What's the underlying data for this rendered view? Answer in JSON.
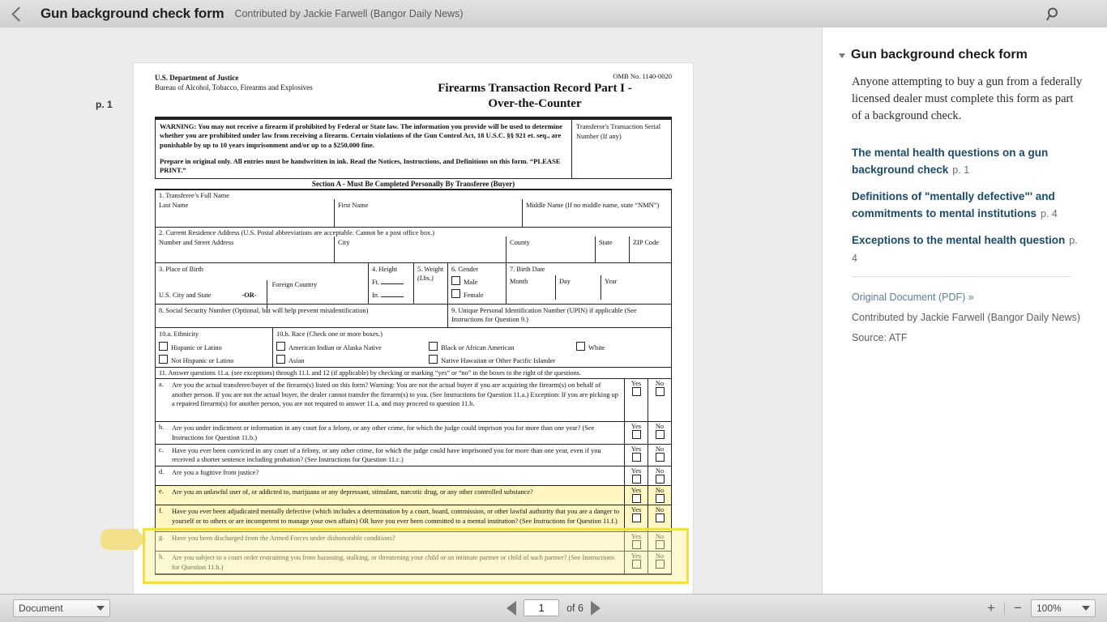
{
  "header": {
    "back_icon": "chevron-left-icon",
    "title": "Gun background check form",
    "credit": "Contributed by Jackie Farwell (Bangor Daily News)",
    "search_icon": "search-icon",
    "menu_icon": "hamburger-menu-icon"
  },
  "viewer": {
    "page_label": "p. 1"
  },
  "form": {
    "omb": "OMB No. 1140-0020",
    "agency_line1": "U.S. Department of Justice",
    "agency_line2": "Bureau of Alcohol, Tobacco, Firearms and Explosives",
    "title_line1": "Firearms Transaction Record Part I -",
    "title_line2": "Over-the-Counter",
    "warning_p1": "WARNING:  You may not receive a firearm if prohibited by Federal or State law.  The information you provide will be used to determine whether you are prohibited under law from receiving a firearm.  Certain violations of the Gun Control Act, 18 U.S.C. §§ 921 et. seq., are punishable by up to 10 years imprisonment and/or up to a $250,000 fine.",
    "warning_p2": "Prepare in original only.  All entries must be handwritten in ink.  Read the Notices, Instructions, and Definitions on this form. “PLEASE PRINT.”",
    "transferor_label": "Transferor's Transaction Serial Number (If any)",
    "section_a": "Section A - Must Be Completed Personally By Transferee (Buyer)",
    "q1_head": "1.   Transferee’s Full Name",
    "q1_last": "Last Name",
    "q1_first": "First Name",
    "q1_middle": "Middle Name (If no middle name, state “NMN”)",
    "q2_head": "2.   Current Residence Address  (U.S. Postal abbreviations are acceptable.  Cannot be a post office box.)",
    "q2_street": "Number and Street Address",
    "q2_city": "City",
    "q2_county": "County",
    "q2_state": "State",
    "q2_zip": "ZIP Code",
    "q3_head": "3.   Place of Birth",
    "q3_us": "U.S. City and State",
    "q3_or": "-OR-",
    "q3_foreign": "Foreign Country",
    "q4_head": "4.  Height",
    "q4_ft": "Ft.",
    "q4_in": "In.",
    "q5_head": "5.  Weight",
    "q5_lbs": "(Lbs.)",
    "q6_head": "6.  Gender",
    "q6_male": "Male",
    "q6_female": "Female",
    "q7_head": "7.  Birth Date",
    "q7_month": "Month",
    "q7_day": "Day",
    "q7_year": "Year",
    "q8": "8.   Social Security Number (Optional, but will help prevent misidentification)",
    "q9": "9.   Unique Personal Identification Number (UPIN) if applicable (See Instructions for Question 9.)",
    "q10a_head": "10.a.  Ethnicity",
    "q10a_opt1": "Hispanic or Latino",
    "q10a_opt2": "Not Hispanic or Latino",
    "q10b_head": "10.b.  Race (Check one or more boxes.)",
    "q10b_opt1": "American Indian or Alaska Native",
    "q10b_opt2": "Black or African American",
    "q10b_opt3": "White",
    "q10b_opt4": "Asian",
    "q10b_opt5": "Native Hawaiian or Other Pacific Islander",
    "q11_intro": "11.   Answer questions 11.a. (see exceptions) through 11.l. and 12 (if applicable) by checking or marking “yes” or “no” in the boxes to the right of the questions.",
    "yes": "Yes",
    "no": "No",
    "questions": [
      {
        "letter": "a.",
        "text": "Are you the actual transferee/buyer of the firearm(s) listed on this form?  Warning:  You are not the actual buyer if you are acquiring the firearm(s) on behalf of another person.  If you are not the actual buyer, the dealer cannot transfer the firearm(s) to you.  (See Instructions for Question 11.a.) Exception:  If you are picking up a repaired firearm(s) for another person, you are not required to answer 11.a. and may proceed to question 11.b.",
        "highlighted": false
      },
      {
        "letter": "b.",
        "text": "Are you under indictment or information in any court for a felony, or any other crime, for which the judge could imprison you for more than one year?  (See Instructions for Question 11.b.)",
        "highlighted": false
      },
      {
        "letter": "c.",
        "text": "Have you ever been convicted in any court of a felony, or any other crime, for which the judge could have imprisoned you for more than one year, even if you received a shorter sentence including probation?  (See Instructions for Question 11.c.)",
        "highlighted": false
      },
      {
        "letter": "d.",
        "text": "Are you a fugitive from justice?",
        "highlighted": false
      },
      {
        "letter": "e.",
        "text": "Are you an unlawful user of, or addicted to, marijuana or any depressant, stimulant, narcotic drug, or any other controlled substance?",
        "highlighted": true
      },
      {
        "letter": "f.",
        "text": "Have you ever been adjudicated mentally defective (which includes a determination by a court, board, commission, or other lawful authority that you are a danger to yourself or to others or are incompetent to manage your own affairs) OR have you ever been committed to a mental institution?  (See Instructions for Question 11.f.)",
        "highlighted": true
      },
      {
        "letter": "g.",
        "text": "Have you been discharged from the Armed Forces under dishonorable conditions?",
        "highlighted": false
      },
      {
        "letter": "h.",
        "text": "Are you subject to a court order restraining you from harassing, stalking, or threatening your child or an intimate partner or child of such partner?  (See Instructions for Question 11.h.)",
        "highlighted": false
      }
    ]
  },
  "sidebar": {
    "title": "Gun background check form",
    "description": "Anyone attempting to buy a gun from a federally licensed dealer must complete this form as part of a background check.",
    "links": [
      {
        "label": "The mental health questions on a gun background check",
        "page": "p. 1"
      },
      {
        "label": "Definitions of \"mentally defective\"' and commitments to mental institutions",
        "page": "p. 4"
      },
      {
        "label": "Exceptions to the mental health question",
        "page": "p. 4"
      }
    ],
    "original_document": "Original Document (PDF) »",
    "contributed_by": "Contributed by Jackie Farwell (Bangor Daily News)",
    "source": "Source: ATF"
  },
  "toolbar": {
    "view_mode": "Document",
    "page_current": "1",
    "page_total": "of 6",
    "zoom_in": "+",
    "zoom_out": "−",
    "zoom_level": "100%"
  },
  "colors": {
    "link": "#1b4a6b",
    "highlight_border": "#f5dd4a",
    "highlight_fill": "#fff6c2",
    "chrome": "#dcdcdc"
  }
}
